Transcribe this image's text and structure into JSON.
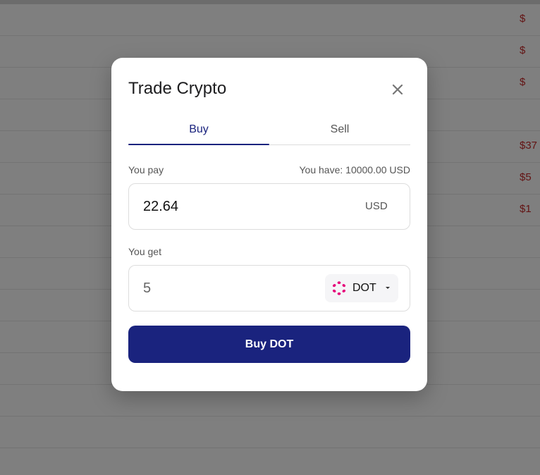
{
  "background": {
    "row_prices": [
      "$",
      "$",
      "$",
      "",
      "$37",
      "$5",
      "$1",
      "",
      "",
      "",
      "",
      "",
      "",
      ""
    ]
  },
  "modal": {
    "title": "Trade Crypto",
    "close_icon": "close-icon",
    "tabs": [
      {
        "label": "Buy",
        "active": true
      },
      {
        "label": "Sell",
        "active": false
      }
    ],
    "pay": {
      "label": "You pay",
      "balance": "You have: 10000.00 USD",
      "value": "22.64",
      "currency": "USD"
    },
    "get": {
      "label": "You get",
      "value": "5",
      "coin": "DOT",
      "coin_icon": "polkadot-icon"
    },
    "submit_label": "Buy DOT"
  },
  "colors": {
    "primary": "#1a237e",
    "coin_accent": "#e6007a",
    "price_red": "#c62828"
  }
}
